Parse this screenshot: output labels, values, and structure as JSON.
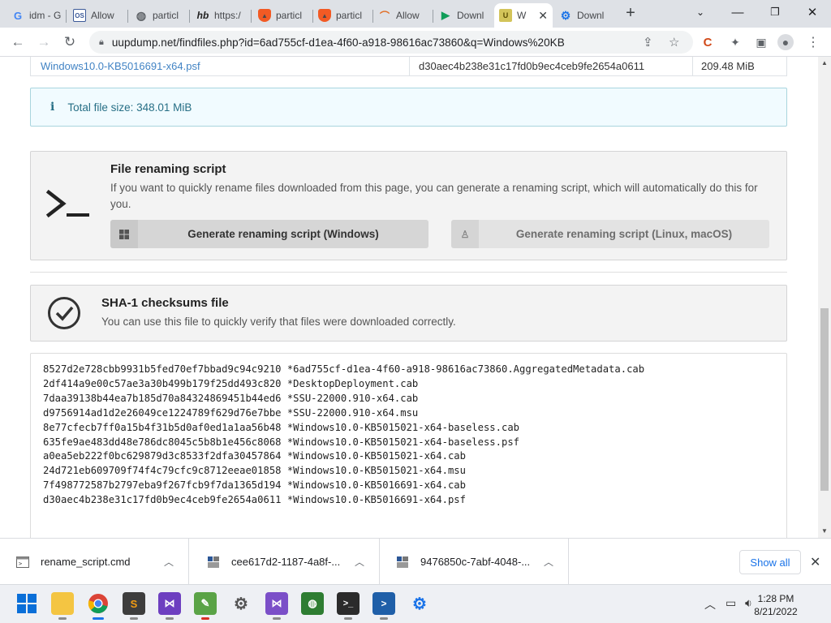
{
  "tabs": [
    {
      "label": "idm - G",
      "icon": "google-icon"
    },
    {
      "label": "Allow",
      "icon": "os-icon"
    },
    {
      "label": "particl",
      "icon": "globe-icon"
    },
    {
      "label": "https:/",
      "icon": "hb-icon"
    },
    {
      "label": "particl",
      "icon": "brave-icon"
    },
    {
      "label": "particl",
      "icon": "brave-icon"
    },
    {
      "label": "Allow",
      "icon": "rainbow-icon"
    },
    {
      "label": "Downl",
      "icon": "play-icon"
    },
    {
      "label": "W",
      "icon": "uup-icon",
      "active": true
    },
    {
      "label": "Downl",
      "icon": "gear-icon"
    }
  ],
  "browser": {
    "url": "uupdump.net/findfiles.php?id=6ad755cf-d1ea-4f60-a918-98616ac73860&q=Windows%20KB"
  },
  "file_row": {
    "name": "Windows10.0-KB5016691-x64.psf",
    "sha1": "d30aec4b238e31c17fd0b9ec4ceb9fe2654a0611",
    "size": "209.48 MiB"
  },
  "total": {
    "text": "Total file size: 348.01 MiB"
  },
  "rename": {
    "title": "File renaming script",
    "desc": "If you want to quickly rename files downloaded from this page, you can generate a renaming script, which will automatically do this for you.",
    "btn_windows": "Generate renaming script (Windows)",
    "btn_linux": "Generate renaming script (Linux, macOS)"
  },
  "checksum": {
    "title": "SHA-1 checksums file",
    "desc": "You can use this file to quickly verify that files were downloaded correctly.",
    "lines": [
      "8527d2e728cbb9931b5fed70ef7bbad9c94c9210 *6ad755cf-d1ea-4f60-a918-98616ac73860.AggregatedMetadata.cab",
      "2df414a9e00c57ae3a30b499b179f25dd493c820 *DesktopDeployment.cab",
      "7daa39138b44ea7b185d70a84324869451b44ed6 *SSU-22000.910-x64.cab",
      "d9756914ad1d2e26049ce1224789f629d76e7bbe *SSU-22000.910-x64.msu",
      "8e77cfecb7ff0a15b4f31b5d0af0ed1a1aa56b48 *Windows10.0-KB5015021-x64-baseless.cab",
      "635fe9ae483dd48e786dc8045c5b8b1e456c8068 *Windows10.0-KB5015021-x64-baseless.psf",
      "a0ea5eb222f0bc629879d3c8533f2dfa30457864 *Windows10.0-KB5015021-x64.cab",
      "24d721eb609709f74f4c79cfc9c8712eeae01858 *Windows10.0-KB5015021-x64.msu",
      "7f498772587b2797eba9f267fcb9f7da1365d194 *Windows10.0-KB5016691-x64.cab",
      "d30aec4b238e31c17fd0b9ec4ceb9fe2654a0611 *Windows10.0-KB5016691-x64.psf"
    ]
  },
  "downloads": {
    "items": [
      {
        "name": "rename_script.cmd"
      },
      {
        "name": "cee617d2-1187-4a8f-..."
      },
      {
        "name": "9476850c-7abf-4048-..."
      }
    ],
    "show_all": "Show all"
  },
  "taskbar": {
    "time": "1:28 PM",
    "date": "8/21/2022"
  }
}
